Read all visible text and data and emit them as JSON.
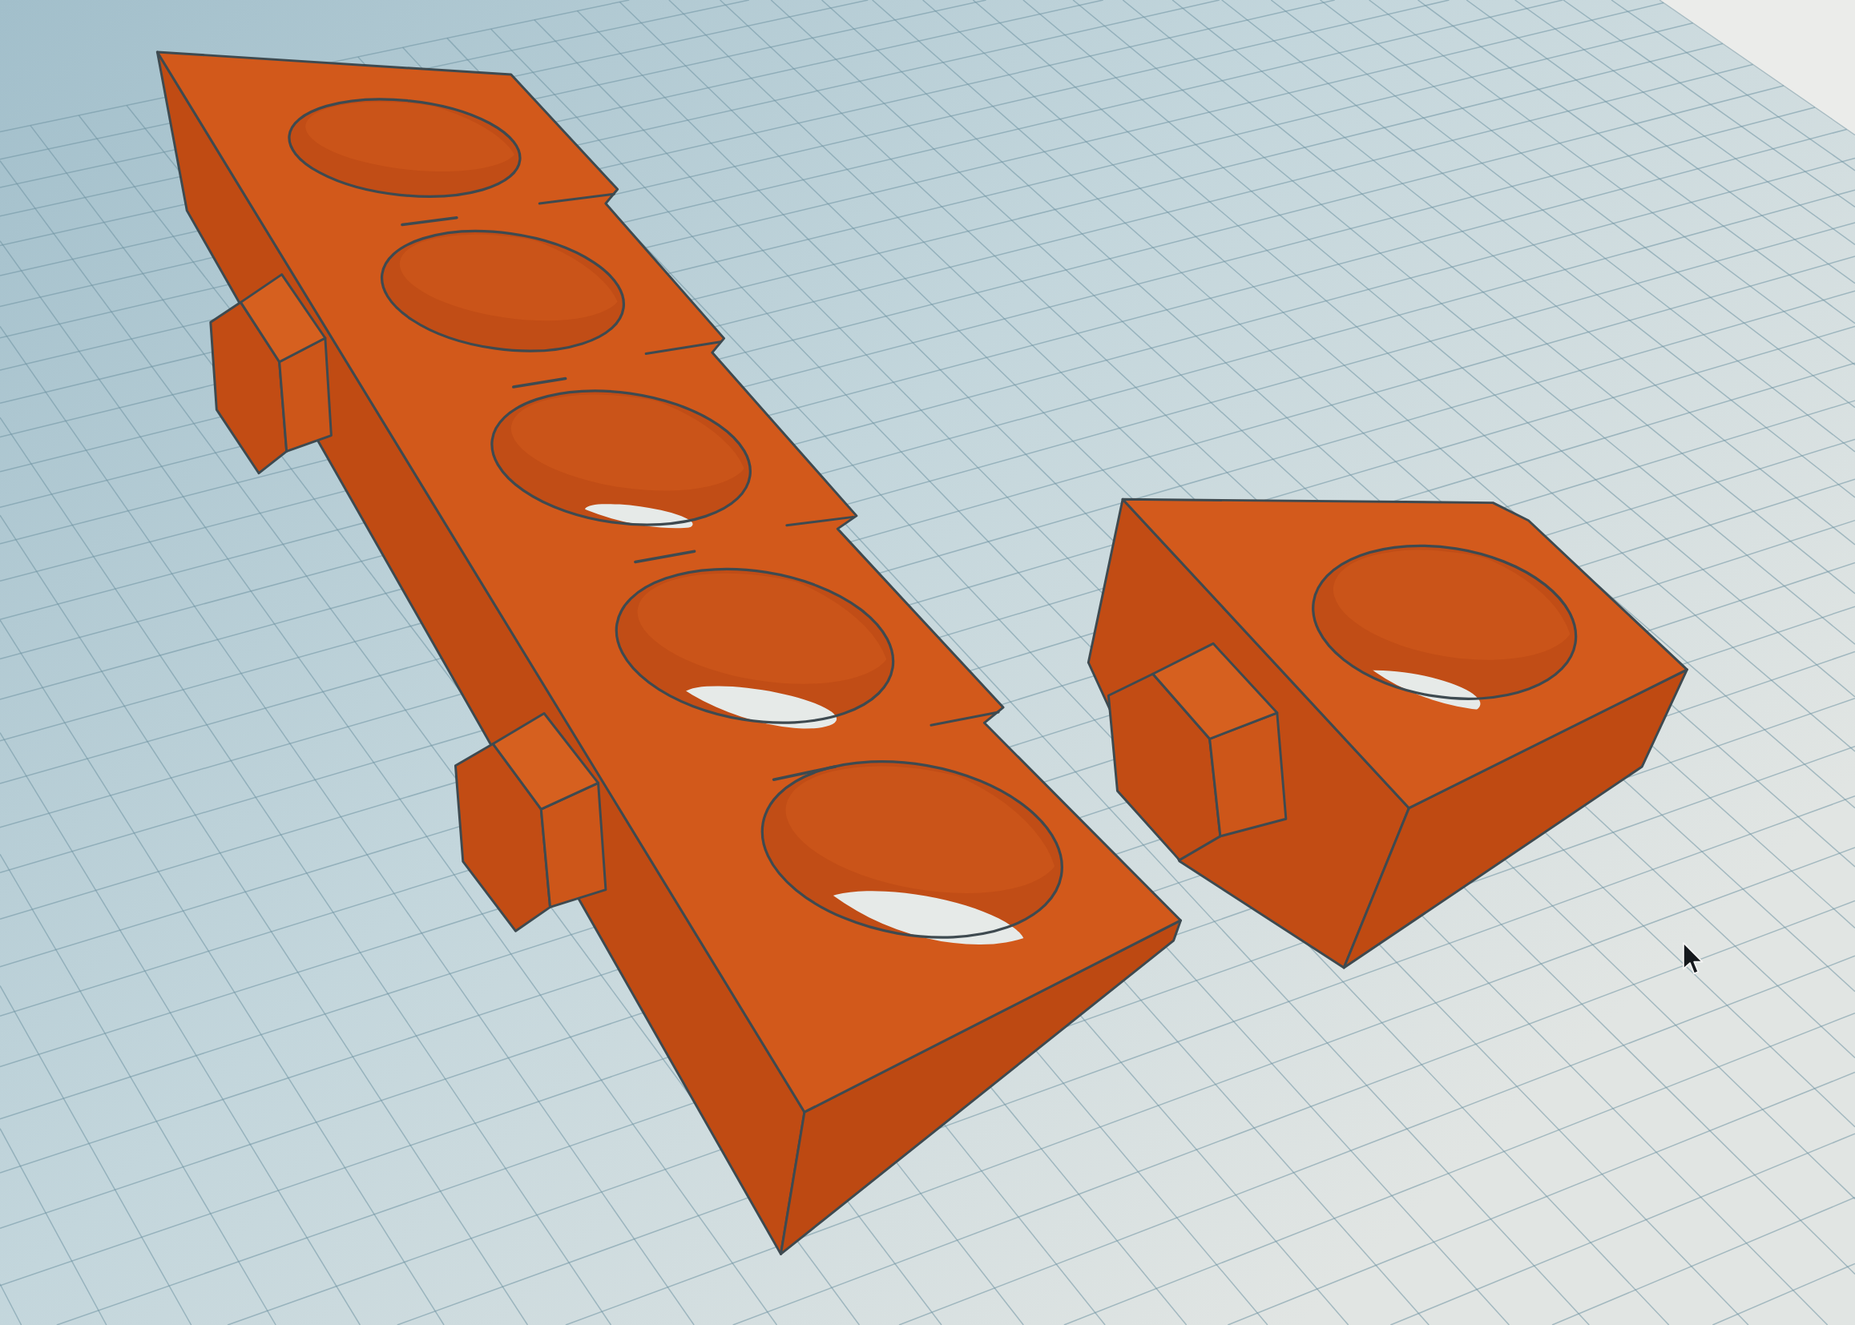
{
  "workplane": {
    "objects": [
      {
        "kind": "bar"
      },
      {
        "kind": "block"
      }
    ]
  }
}
